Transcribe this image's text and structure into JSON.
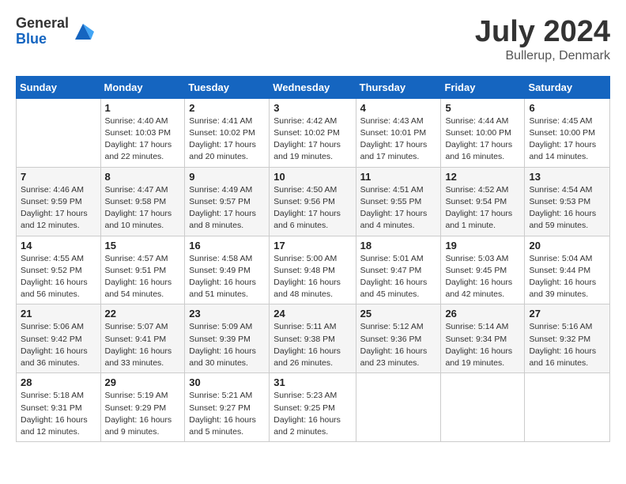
{
  "logo": {
    "general": "General",
    "blue": "Blue"
  },
  "title": "July 2024",
  "location": "Bullerup, Denmark",
  "days_header": [
    "Sunday",
    "Monday",
    "Tuesday",
    "Wednesday",
    "Thursday",
    "Friday",
    "Saturday"
  ],
  "weeks": [
    [
      {
        "day": "",
        "info": ""
      },
      {
        "day": "1",
        "info": "Sunrise: 4:40 AM\nSunset: 10:03 PM\nDaylight: 17 hours\nand 22 minutes."
      },
      {
        "day": "2",
        "info": "Sunrise: 4:41 AM\nSunset: 10:02 PM\nDaylight: 17 hours\nand 20 minutes."
      },
      {
        "day": "3",
        "info": "Sunrise: 4:42 AM\nSunset: 10:02 PM\nDaylight: 17 hours\nand 19 minutes."
      },
      {
        "day": "4",
        "info": "Sunrise: 4:43 AM\nSunset: 10:01 PM\nDaylight: 17 hours\nand 17 minutes."
      },
      {
        "day": "5",
        "info": "Sunrise: 4:44 AM\nSunset: 10:00 PM\nDaylight: 17 hours\nand 16 minutes."
      },
      {
        "day": "6",
        "info": "Sunrise: 4:45 AM\nSunset: 10:00 PM\nDaylight: 17 hours\nand 14 minutes."
      }
    ],
    [
      {
        "day": "7",
        "info": "Sunrise: 4:46 AM\nSunset: 9:59 PM\nDaylight: 17 hours\nand 12 minutes."
      },
      {
        "day": "8",
        "info": "Sunrise: 4:47 AM\nSunset: 9:58 PM\nDaylight: 17 hours\nand 10 minutes."
      },
      {
        "day": "9",
        "info": "Sunrise: 4:49 AM\nSunset: 9:57 PM\nDaylight: 17 hours\nand 8 minutes."
      },
      {
        "day": "10",
        "info": "Sunrise: 4:50 AM\nSunset: 9:56 PM\nDaylight: 17 hours\nand 6 minutes."
      },
      {
        "day": "11",
        "info": "Sunrise: 4:51 AM\nSunset: 9:55 PM\nDaylight: 17 hours\nand 4 minutes."
      },
      {
        "day": "12",
        "info": "Sunrise: 4:52 AM\nSunset: 9:54 PM\nDaylight: 17 hours\nand 1 minute."
      },
      {
        "day": "13",
        "info": "Sunrise: 4:54 AM\nSunset: 9:53 PM\nDaylight: 16 hours\nand 59 minutes."
      }
    ],
    [
      {
        "day": "14",
        "info": "Sunrise: 4:55 AM\nSunset: 9:52 PM\nDaylight: 16 hours\nand 56 minutes."
      },
      {
        "day": "15",
        "info": "Sunrise: 4:57 AM\nSunset: 9:51 PM\nDaylight: 16 hours\nand 54 minutes."
      },
      {
        "day": "16",
        "info": "Sunrise: 4:58 AM\nSunset: 9:49 PM\nDaylight: 16 hours\nand 51 minutes."
      },
      {
        "day": "17",
        "info": "Sunrise: 5:00 AM\nSunset: 9:48 PM\nDaylight: 16 hours\nand 48 minutes."
      },
      {
        "day": "18",
        "info": "Sunrise: 5:01 AM\nSunset: 9:47 PM\nDaylight: 16 hours\nand 45 minutes."
      },
      {
        "day": "19",
        "info": "Sunrise: 5:03 AM\nSunset: 9:45 PM\nDaylight: 16 hours\nand 42 minutes."
      },
      {
        "day": "20",
        "info": "Sunrise: 5:04 AM\nSunset: 9:44 PM\nDaylight: 16 hours\nand 39 minutes."
      }
    ],
    [
      {
        "day": "21",
        "info": "Sunrise: 5:06 AM\nSunset: 9:42 PM\nDaylight: 16 hours\nand 36 minutes."
      },
      {
        "day": "22",
        "info": "Sunrise: 5:07 AM\nSunset: 9:41 PM\nDaylight: 16 hours\nand 33 minutes."
      },
      {
        "day": "23",
        "info": "Sunrise: 5:09 AM\nSunset: 9:39 PM\nDaylight: 16 hours\nand 30 minutes."
      },
      {
        "day": "24",
        "info": "Sunrise: 5:11 AM\nSunset: 9:38 PM\nDaylight: 16 hours\nand 26 minutes."
      },
      {
        "day": "25",
        "info": "Sunrise: 5:12 AM\nSunset: 9:36 PM\nDaylight: 16 hours\nand 23 minutes."
      },
      {
        "day": "26",
        "info": "Sunrise: 5:14 AM\nSunset: 9:34 PM\nDaylight: 16 hours\nand 19 minutes."
      },
      {
        "day": "27",
        "info": "Sunrise: 5:16 AM\nSunset: 9:32 PM\nDaylight: 16 hours\nand 16 minutes."
      }
    ],
    [
      {
        "day": "28",
        "info": "Sunrise: 5:18 AM\nSunset: 9:31 PM\nDaylight: 16 hours\nand 12 minutes."
      },
      {
        "day": "29",
        "info": "Sunrise: 5:19 AM\nSunset: 9:29 PM\nDaylight: 16 hours\nand 9 minutes."
      },
      {
        "day": "30",
        "info": "Sunrise: 5:21 AM\nSunset: 9:27 PM\nDaylight: 16 hours\nand 5 minutes."
      },
      {
        "day": "31",
        "info": "Sunrise: 5:23 AM\nSunset: 9:25 PM\nDaylight: 16 hours\nand 2 minutes."
      },
      {
        "day": "",
        "info": ""
      },
      {
        "day": "",
        "info": ""
      },
      {
        "day": "",
        "info": ""
      }
    ]
  ]
}
